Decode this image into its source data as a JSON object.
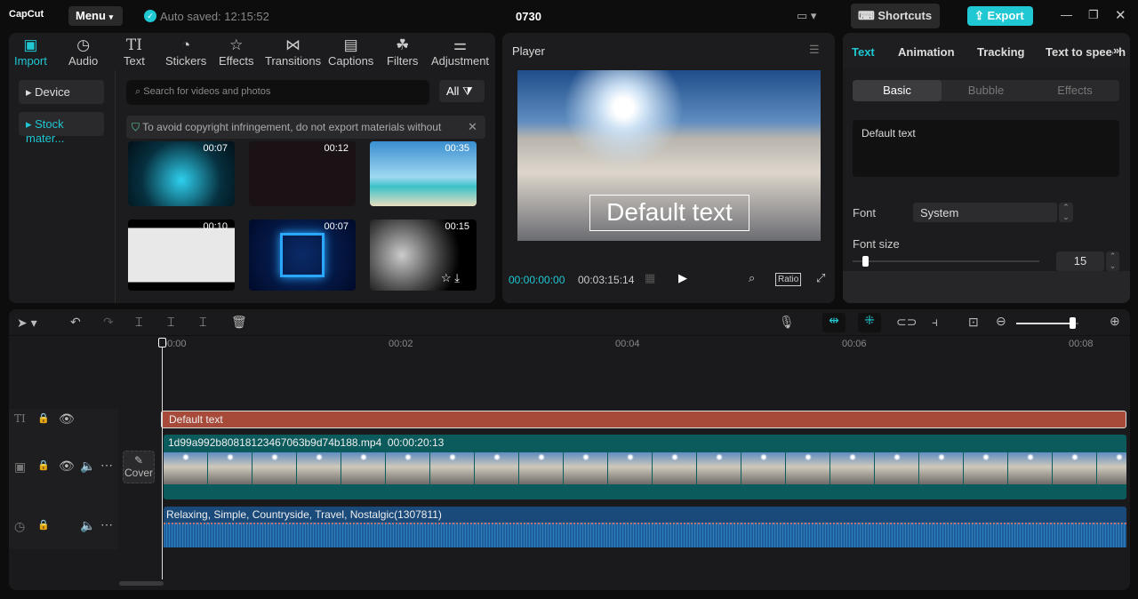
{
  "topbar": {
    "logo": "CapCut",
    "menu": "Menu",
    "autosave": "Auto saved: 12:15:52",
    "project": "0730",
    "shortcuts": "Shortcuts",
    "export": "Export"
  },
  "media_tabs": [
    {
      "label": "Import",
      "icon": "import-icon"
    },
    {
      "label": "Audio",
      "icon": "audio-icon"
    },
    {
      "label": "Text",
      "icon": "text-icon"
    },
    {
      "label": "Stickers",
      "icon": "stickers-icon"
    },
    {
      "label": "Effects",
      "icon": "effects-icon"
    },
    {
      "label": "Transitions",
      "icon": "transitions-icon"
    },
    {
      "label": "Captions",
      "icon": "captions-icon"
    },
    {
      "label": "Filters",
      "icon": "filters-icon"
    },
    {
      "label": "Adjustment",
      "icon": "adjustment-icon"
    }
  ],
  "sidebar": {
    "device": "Device",
    "stock": "Stock mater..."
  },
  "search": {
    "placeholder": "Search for videos and photos",
    "filter": "All"
  },
  "notice": "To avoid copyright infringement, do not export materials without",
  "thumbs": [
    {
      "duration": "00:07"
    },
    {
      "duration": "00:12"
    },
    {
      "duration": "00:35"
    },
    {
      "duration": "00:10"
    },
    {
      "duration": "00:07"
    },
    {
      "duration": "00:15"
    }
  ],
  "player": {
    "title": "Player",
    "overlay_text": "Default text",
    "current": "00:00:00:00",
    "total": "00:03:15:14",
    "ratio": "Ratio"
  },
  "right": {
    "tabs": [
      "Text",
      "Animation",
      "Tracking",
      "Text to speech"
    ],
    "subtabs": [
      "Basic",
      "Bubble",
      "Effects"
    ],
    "text_value": "Default text",
    "font_label": "Font",
    "font_value": "System",
    "size_label": "Font size",
    "size_value": "15",
    "size_fraction": 0.05
  },
  "timeline": {
    "ruler": [
      "00:00",
      "00:02",
      "00:04",
      "00:06",
      "00:08"
    ],
    "zoom_fraction": 0.9,
    "text_clip": "Default text",
    "video_name": "1d99a992b80818123467063b9d74b188.mp4",
    "video_dur": "00:00:20:13",
    "audio_name": "Relaxing, Simple, Countryside, Travel, Nostalgic(1307811)",
    "cover": "Cover"
  },
  "colors": {
    "accent": "#1fc8d3",
    "text_clip": "#a84a3a",
    "video_clip": "#0c5b5c",
    "audio_clip": "#1a4a7a"
  }
}
